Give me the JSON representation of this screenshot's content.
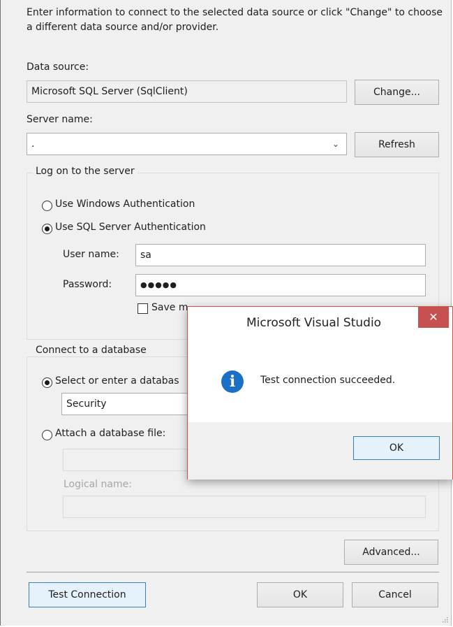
{
  "intro_text": "Enter information to connect to the selected data source or click \"Change\" to choose a different data source and/or provider.",
  "data_source": {
    "label": "Data source:",
    "value": "Microsoft SQL Server (SqlClient)",
    "change_label": "Change..."
  },
  "server": {
    "label": "Server name:",
    "value": ".",
    "refresh_label": "Refresh"
  },
  "logon": {
    "legend": "Log on to the server",
    "windows_auth": "Use Windows Authentication",
    "sql_auth": "Use SQL Server Authentication",
    "user_label": "User name:",
    "user_value": "sa",
    "password_label": "Password:",
    "password_value": "●●●●●",
    "save_password_partial": "Save m"
  },
  "database": {
    "legend": "Connect to a database",
    "select_label": "Select or enter a databas",
    "select_value": "Security",
    "attach_label": "Attach a database file:",
    "attach_value": "",
    "logical_label": "Logical name:",
    "logical_value": ""
  },
  "buttons": {
    "advanced": "Advanced...",
    "test": "Test Connection",
    "ok": "OK",
    "cancel": "Cancel"
  },
  "messagebox": {
    "title": "Microsoft Visual Studio",
    "close": "✕",
    "message": "Test connection succeeded.",
    "ok": "OK",
    "icon": "info-icon"
  }
}
